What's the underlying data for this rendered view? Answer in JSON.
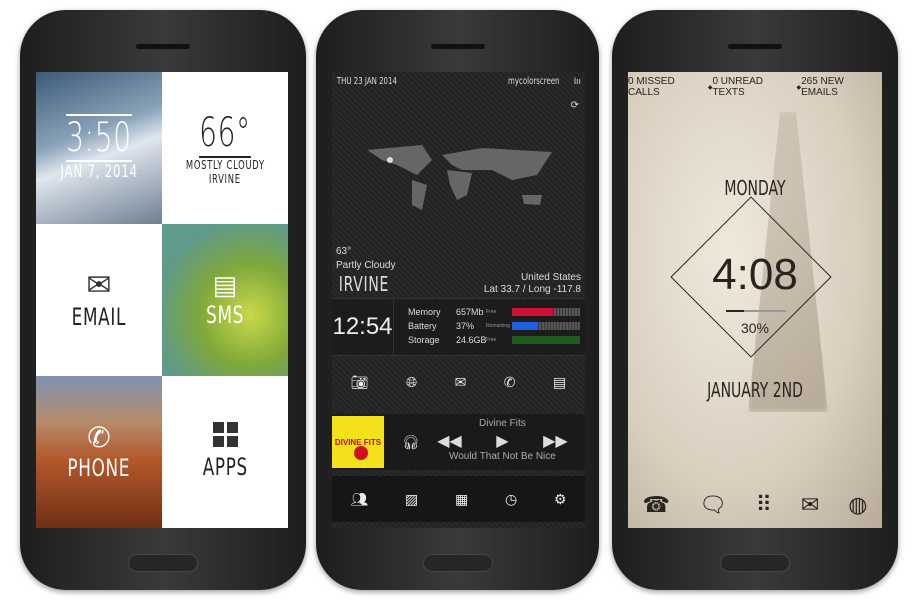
{
  "phone1": {
    "clock": {
      "time": "3:50",
      "date": "JAN 7, 2014"
    },
    "weather": {
      "temp": "66°",
      "condition": "MOSTLY CLOUDY",
      "city": "IRVINE"
    },
    "tiles": {
      "email": "EMAIL",
      "sms": "SMS",
      "phone": "PHONE",
      "apps": "APPS"
    }
  },
  "phone2": {
    "date": "THU 23 JAN 2014",
    "site": "mycolorscreen",
    "weather": {
      "temp": "63°",
      "condition": "Partly Cloudy",
      "city": "IRVINE"
    },
    "location": {
      "country": "United States",
      "coords": "Lat 33.7 / Long -117.8"
    },
    "time": "12:54",
    "stats": [
      {
        "label": "Memory",
        "value": "657Mb",
        "unit": "Free",
        "fill": 0.6,
        "color": "#d0103a"
      },
      {
        "label": "Battery",
        "value": "37%",
        "unit": "Remaining",
        "fill": 0.37,
        "color": "#1f5fe0"
      },
      {
        "label": "Storage",
        "value": "24.6GB",
        "unit": "Free",
        "fill": 1.0,
        "color": "#1f5a1f"
      }
    ],
    "music": {
      "album_art_text": "DIVINE FITS",
      "artist": "Divine Fits",
      "track": "Would That Not Be Nice"
    }
  },
  "phone3": {
    "notifications": {
      "missed": "0 MISSED CALLS",
      "texts": "0 UNREAD TEXTS",
      "emails": "265 NEW EMAILS",
      "separator": "◆"
    },
    "day": "MONDAY",
    "time": "4:08",
    "battery": "30%",
    "date": "JANUARY 2ND"
  }
}
